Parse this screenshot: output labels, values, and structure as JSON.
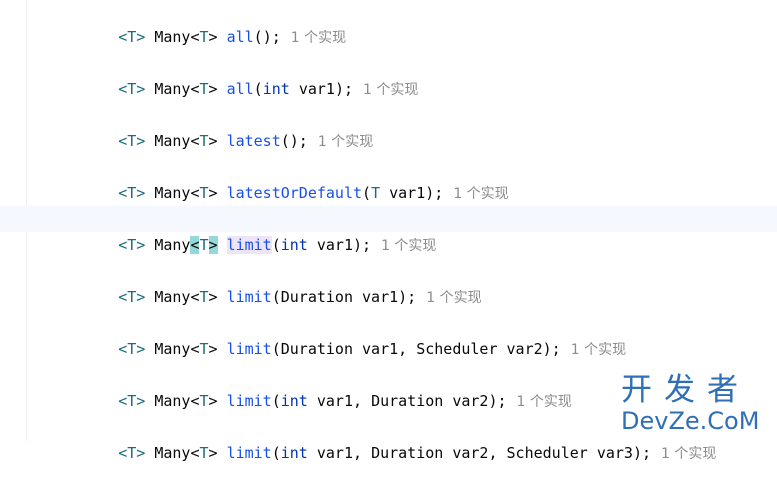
{
  "editor": {
    "lines": [
      {
        "type_param": "<T>",
        "return_type": "Many",
        "generic_open": "<",
        "generic_T": "T",
        "generic_close": ">",
        "method": "all",
        "params_open": "(",
        "params": [],
        "params_close": ");",
        "hint": "1 个实现"
      },
      {
        "type_param": "<T>",
        "return_type": "Many",
        "generic_open": "<",
        "generic_T": "T",
        "generic_close": ">",
        "method": "all",
        "params_open": "(",
        "params": [
          {
            "type": "int",
            "name": "var1"
          }
        ],
        "params_close": ");",
        "hint": "1 个实现"
      },
      {
        "type_param": "<T>",
        "return_type": "Many",
        "generic_open": "<",
        "generic_T": "T",
        "generic_close": ">",
        "method": "latest",
        "params_open": "(",
        "params": [],
        "params_close": ");",
        "hint": "1 个实现"
      },
      {
        "type_param": "<T>",
        "return_type": "Many",
        "generic_open": "<",
        "generic_T": "T",
        "generic_close": ">",
        "method": "latestOrDefault",
        "params_open": "(",
        "params": [
          {
            "type": "T",
            "name": "var1"
          }
        ],
        "params_close": ");",
        "hint": "1 个实现"
      },
      {
        "type_param": "<T>",
        "return_type": "Many",
        "generic_open": "<",
        "generic_T": "T",
        "generic_close": ">",
        "method": "limit",
        "params_open": "(",
        "params": [
          {
            "type": "int",
            "name": "var1"
          }
        ],
        "params_close": ");",
        "hint": "1 个实现"
      },
      {
        "type_param": "<T>",
        "return_type": "Many",
        "generic_open": "<",
        "generic_T": "T",
        "generic_close": ">",
        "method": "limit",
        "params_open": "(",
        "params": [
          {
            "type": "Duration",
            "name": "var1"
          }
        ],
        "params_close": ");",
        "hint": "1 个实现"
      },
      {
        "type_param": "<T>",
        "return_type": "Many",
        "generic_open": "<",
        "generic_T": "T",
        "generic_close": ">",
        "method": "limit",
        "params_open": "(",
        "params": [
          {
            "type": "Duration",
            "name": "var1"
          },
          {
            "type": "Scheduler",
            "name": "var2"
          }
        ],
        "params_close": ");",
        "hint": "1 个实现"
      },
      {
        "type_param": "<T>",
        "return_type": "Many",
        "generic_open": "<",
        "generic_T": "T",
        "generic_close": ">",
        "method": "limit",
        "params_open": "(",
        "params": [
          {
            "type": "int",
            "name": "var1"
          },
          {
            "type": "Duration",
            "name": "var2"
          }
        ],
        "params_close": ");",
        "hint": "1 个实现"
      },
      {
        "type_param": "<T>",
        "return_type": "Many",
        "generic_open": "<",
        "generic_T": "T",
        "generic_close": ">",
        "method": "limit",
        "params_open": "(",
        "params": [
          {
            "type": "int",
            "name": "var1"
          },
          {
            "type": "Duration",
            "name": "var2"
          },
          {
            "type": "Scheduler",
            "name": "var3"
          }
        ],
        "params_close": ");",
        "hint": "1 个实现"
      }
    ],
    "current_line": 4,
    "colors": {
      "type_param": "#1a6b7c",
      "method": "#1750eb",
      "keyword": "#0033b3",
      "hint": "#8c8c8c",
      "current_line_bg": "#f5f8fe",
      "bracket_match": "#93d9d9",
      "identifier_highlight": "#ede4f6"
    }
  },
  "watermark": {
    "line1": "开发者",
    "line2": "DevZe.CoM",
    "color": "#2f6fb6"
  }
}
